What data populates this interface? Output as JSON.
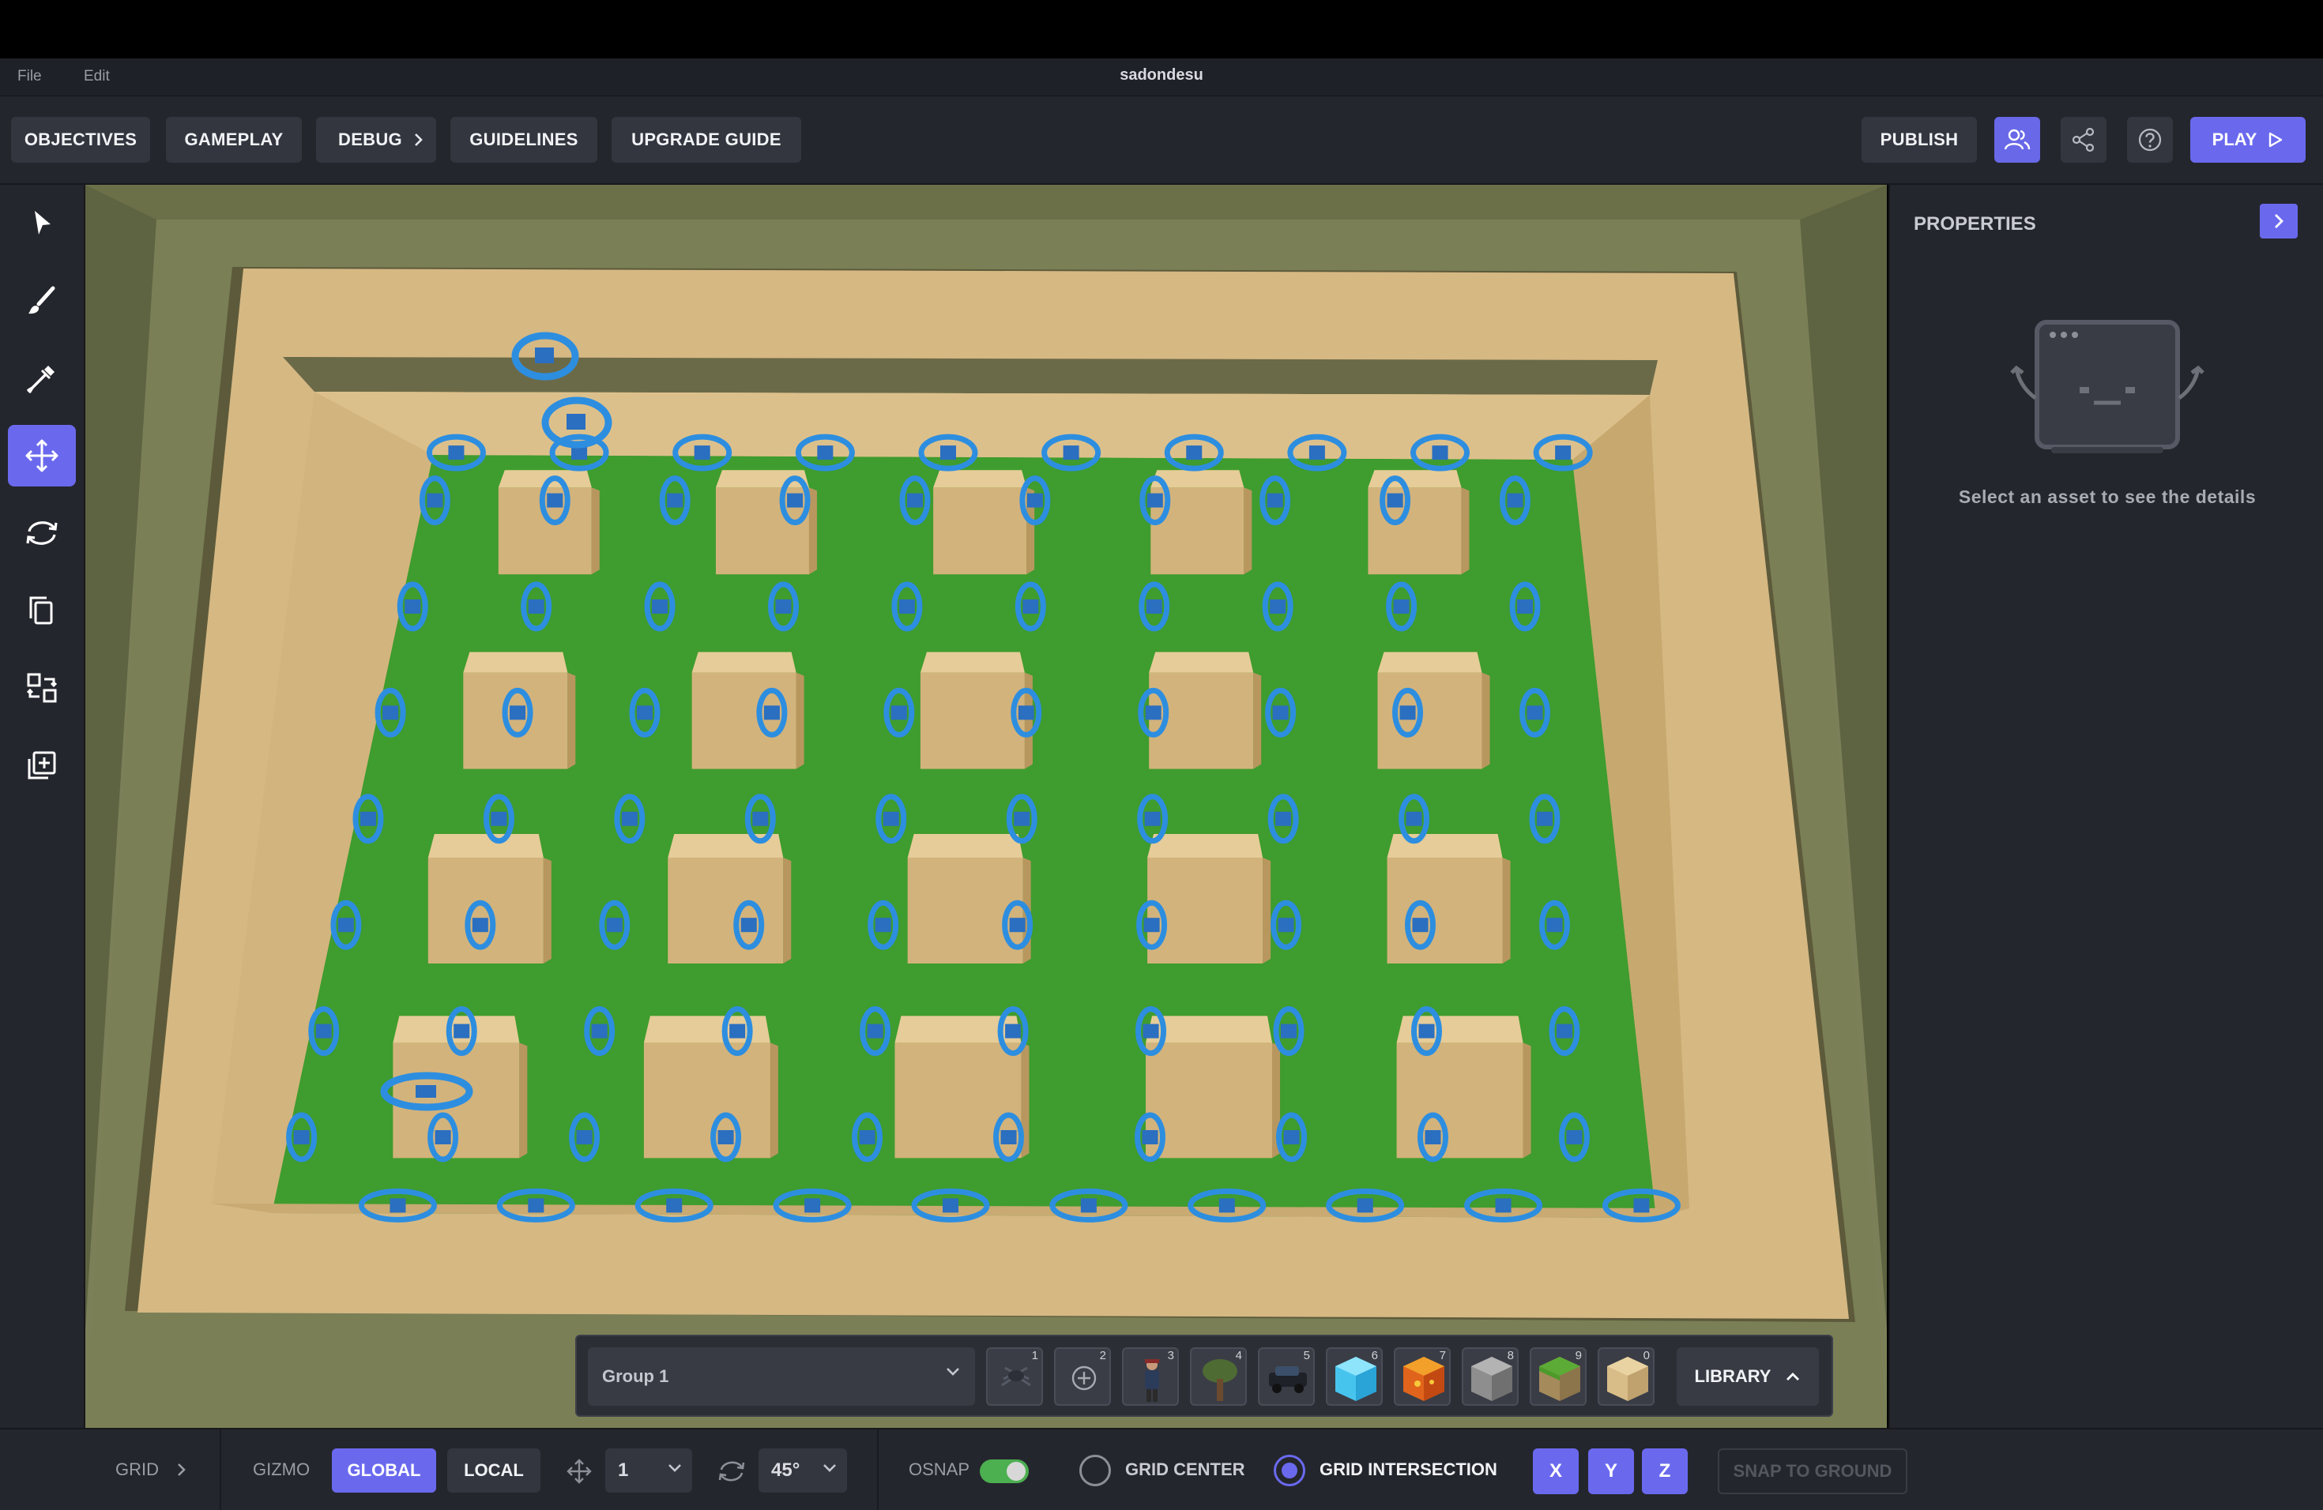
{
  "window": {
    "title": "sadondesu"
  },
  "menu": {
    "file": "File",
    "edit": "Edit"
  },
  "toolbar": {
    "objectives": "OBJECTIVES",
    "gameplay": "GAMEPLAY",
    "debug": "DEBUG",
    "guidelines": "GUIDELINES",
    "upgrade_guide": "UPGRADE GUIDE",
    "publish": "PUBLISH",
    "play": "PLAY",
    "icons": [
      "collaborators-icon",
      "share-icon",
      "help-icon",
      "play-icon",
      "chevron-right-icon"
    ]
  },
  "tools": [
    {
      "name": "select-tool",
      "icon": "cursor-icon",
      "active": false
    },
    {
      "name": "paint-tool",
      "icon": "brush-icon",
      "active": false
    },
    {
      "name": "eyedropper-tool",
      "icon": "eyedropper-icon",
      "active": false
    },
    {
      "name": "move-tool",
      "icon": "move-arrows-icon",
      "active": true
    },
    {
      "name": "rotate-tool",
      "icon": "rotate-icon",
      "active": false
    },
    {
      "name": "duplicate-tool",
      "icon": "copy-icon",
      "active": false
    },
    {
      "name": "swap-tool",
      "icon": "swap-icon",
      "active": false
    },
    {
      "name": "add-tool",
      "icon": "add-box-icon",
      "active": false
    }
  ],
  "properties": {
    "title": "PROPERTIES",
    "empty_message": "Select an asset to see the details"
  },
  "hotbar": {
    "group": "Group 1",
    "slots": [
      {
        "num": "1",
        "asset": "spider-icon"
      },
      {
        "num": "2",
        "asset": "target-icon"
      },
      {
        "num": "3",
        "asset": "character-icon"
      },
      {
        "num": "4",
        "asset": "tree-icon"
      },
      {
        "num": "5",
        "asset": "car-icon"
      },
      {
        "num": "6",
        "asset": "diamond-block-icon"
      },
      {
        "num": "7",
        "asset": "lava-block-icon"
      },
      {
        "num": "8",
        "asset": "stone-block-icon"
      },
      {
        "num": "9",
        "asset": "grass-block-icon"
      },
      {
        "num": "0",
        "asset": "sand-block-icon"
      }
    ],
    "library": "LIBRARY"
  },
  "bottombar": {
    "grid": "GRID",
    "gizmo": "GIZMO",
    "global": "GLOBAL",
    "local": "LOCAL",
    "move_step": "1",
    "rotate_step": "45°",
    "osnap": "OSNAP",
    "osnap_on": true,
    "grid_center": "GRID CENTER",
    "grid_intersection": "GRID INTERSECTION",
    "grid_mode_selected": "GRID INTERSECTION",
    "axis_x": "X",
    "axis_y": "Y",
    "axis_z": "Z",
    "snap_to_ground": "SNAP TO GROUND"
  },
  "colors": {
    "accent": "#6a69ee",
    "panel": "#24262d",
    "sand": "#d9bc86",
    "grass": "#3f9c2e",
    "ring": "#2d8ee0"
  }
}
